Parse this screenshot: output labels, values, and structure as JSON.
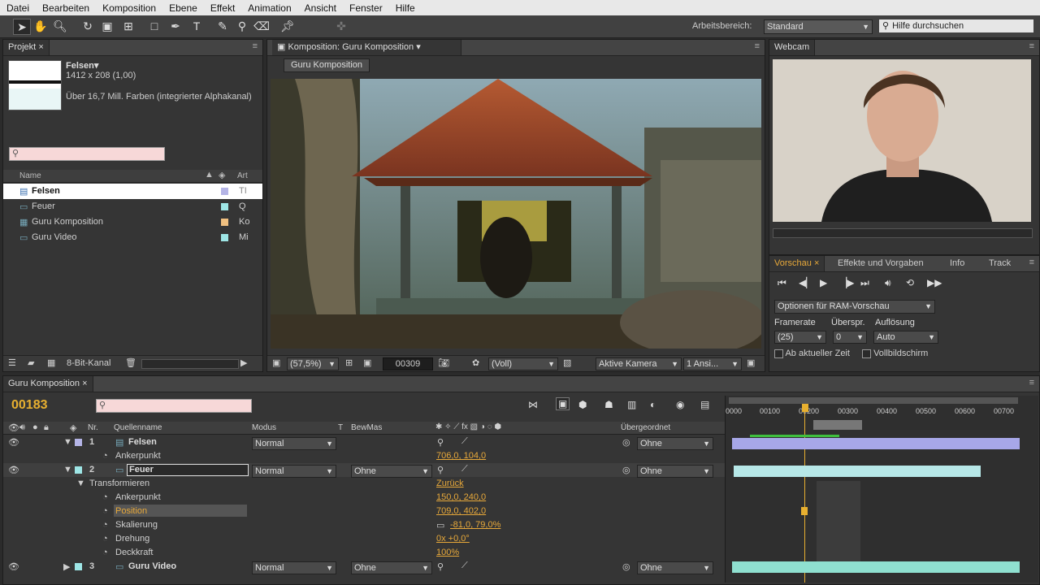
{
  "menu": [
    "Datei",
    "Bearbeiten",
    "Komposition",
    "Ebene",
    "Effekt",
    "Animation",
    "Ansicht",
    "Fenster",
    "Hilfe"
  ],
  "toolbar": {
    "workspace_label": "Arbeitsbereich:",
    "workspace_value": "Standard",
    "help_placeholder": "Hilfe durchsuchen"
  },
  "project": {
    "tab": "Projekt",
    "selected_name": "Felsen▾",
    "dimensions": "1412 x 208 (1,00)",
    "colors": "Über 16,7 Mill. Farben (integrierter Alphakanal)",
    "col_name": "Name",
    "col_type": "Art",
    "items": [
      {
        "name": "Felsen",
        "type": "TI",
        "color": "#b4b4e6"
      },
      {
        "name": "Feuer",
        "type": "Q",
        "color": "#9ee6e6"
      },
      {
        "name": "Guru Komposition",
        "type": "Ko",
        "color": "#f0c080"
      },
      {
        "name": "Guru Video",
        "type": "Mi",
        "color": "#9ee6e6"
      }
    ],
    "bit_depth": "8-Bit-Kanal"
  },
  "composition": {
    "tab": "Komposition: Guru Komposition",
    "breadcrumb": "Guru Komposition",
    "zoom": "(57,5%)",
    "frame": "00309",
    "resolution": "(Voll)",
    "camera": "Aktive Kamera",
    "views": "1 Ansi..."
  },
  "webcam": {
    "tab": "Webcam"
  },
  "preview": {
    "tabs": [
      "Vorschau",
      "Effekte und Vorgaben",
      "Info",
      "Track"
    ],
    "ram_options": "Optionen für RAM-Vorschau",
    "framerate_label": "Framerate",
    "skip_label": "Überspr.",
    "res_label": "Auflösung",
    "framerate": "(25)",
    "skip": "0",
    "res": "Auto",
    "from_current": "Ab aktueller Zeit",
    "fullscreen": "Vollbildschirm"
  },
  "timeline": {
    "tab": "Guru Komposition",
    "timecode": "00183",
    "headers": {
      "nr": "Nr.",
      "source": "Quellenname",
      "mode": "Modus",
      "t": "T",
      "trkmat": "BewMas",
      "parent": "Übergeordnet"
    },
    "ruler": [
      "0000",
      "00100",
      "00200",
      "00300",
      "00400",
      "00500",
      "00600",
      "00700"
    ],
    "layers": [
      {
        "nr": "1",
        "name": "Felsen",
        "mode": "Normal",
        "parent": "Ohne",
        "color": "#b4b4e6"
      },
      {
        "nr": "2",
        "name": "Feuer",
        "mode": "Normal",
        "trkmat": "Ohne",
        "parent": "Ohne",
        "color": "#9ee6e6"
      },
      {
        "nr": "3",
        "name": "Guru Video",
        "mode": "Normal",
        "trkmat": "Ohne",
        "parent": "Ohne",
        "color": "#9ee6e6"
      }
    ],
    "props": {
      "anchor1_label": "Ankerpunkt",
      "anchor1_value": "706,0, 104,0",
      "transform": "Transformieren",
      "reset": "Zurück",
      "anchor2_label": "Ankerpunkt",
      "anchor2_value": "150,0, 240,0",
      "position_label": "Position",
      "position_value": "709,0, 402,0",
      "scale_label": "Skalierung",
      "scale_value": "-81,0, 79,0%",
      "rotation_label": "Drehung",
      "rotation_value": "0x +0,0°",
      "opacity_label": "Deckkraft",
      "opacity_value": "100%"
    }
  }
}
